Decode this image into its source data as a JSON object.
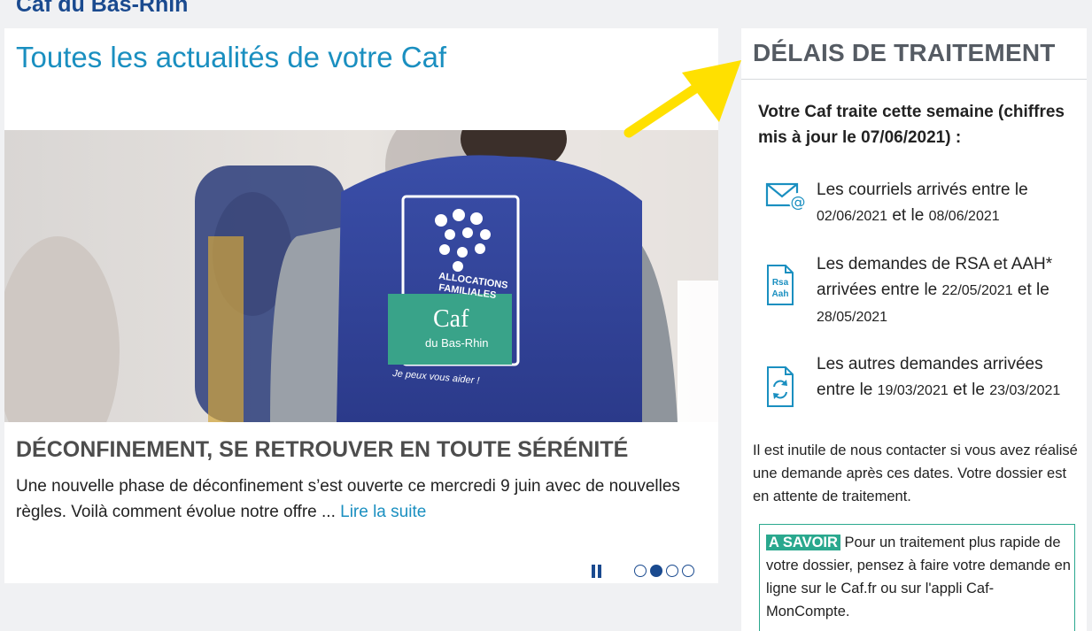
{
  "site": {
    "title": "Caf du Bas-Rhin"
  },
  "news": {
    "heading": "Toutes les actualités de votre Caf",
    "vest_lines": [
      "ALLOCATIONS",
      "FAMILIALES",
      "Caf",
      "du Bas-Rhin",
      "Je peux vous aider !"
    ],
    "subtitle": "DÉCONFINEMENT, SE RETROUVER EN TOUTE SÉRÉNITÉ",
    "text": "Une nouvelle phase de déconfinement s’est ouverte ce mercredi 9 juin avec de nouvelles règles. Voilà comment évolue notre offre ...",
    "link": "Lire la suite",
    "carousel": {
      "slides": 4,
      "active": 2
    }
  },
  "delais": {
    "title": "DÉLAIS DE TRAITEMENT",
    "intro": "Votre Caf traite cette semaine (chiffres mis à jour le 07/06/2021) :",
    "items": [
      {
        "icon": "email-icon",
        "text_a": "Les courriels arrivés entre le ",
        "date1": "02/06/2021",
        "mid": " et le ",
        "date2": "08/06/2021",
        "end": ""
      },
      {
        "icon": "rsa-aah-icon",
        "icon_text": "Rsa\nAah",
        "text_a": "Les demandes de RSA et AAH* arrivées entre le ",
        "date1": "22/05/2021",
        "mid": " et le ",
        "date2": "28/05/2021",
        "end": ""
      },
      {
        "icon": "document-refresh-icon",
        "text_a": "Les autres demandes arrivées entre le ",
        "date1": "19/03/2021",
        "mid": " et le ",
        "date2": "23/03/2021",
        "end": ""
      }
    ],
    "note": "Il est inutile de nous contacter si vous avez réalisé une demande après ces dates. Votre dossier est en attente de traitement.",
    "savoir": {
      "badge": "A SAVOIR",
      "text": " Pour un traitement plus rapide de votre dossier, pensez à faire votre demande en ligne sur le Caf.fr ou sur l'appli Caf-MonCompte."
    }
  },
  "colors": {
    "brand_blue": "#1a4a8f",
    "link_blue": "#1a8fc0",
    "green": "#2aa88e",
    "arrow_yellow": "#ffe000"
  }
}
